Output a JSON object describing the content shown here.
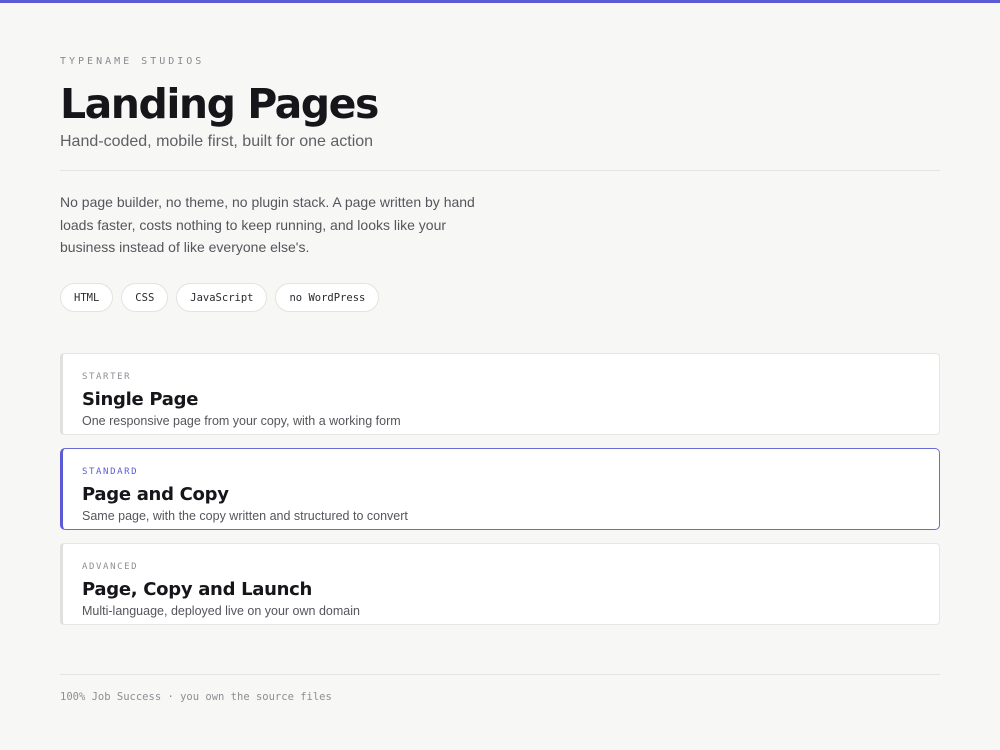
{
  "header": {
    "eyebrow": "TYPENAME STUDIOS",
    "title": "Landing Pages",
    "subtitle": "Hand-coded, mobile first, built for one action"
  },
  "intro": "No page builder, no theme, no plugin stack. A page written by hand loads faster, costs nothing to keep running, and looks like your business instead of like everyone else's.",
  "tags": [
    "HTML",
    "CSS",
    "JavaScript",
    "no WordPress"
  ],
  "packages": [
    {
      "tier": "STARTER",
      "name": "Single Page",
      "description": "One responsive page from your copy, with a working form",
      "selected": false
    },
    {
      "tier": "STANDARD",
      "name": "Page and Copy",
      "description": "Same page, with the copy written and structured to convert",
      "selected": true
    },
    {
      "tier": "ADVANCED",
      "name": "Page, Copy and Launch",
      "description": "Multi-language, deployed live on your own domain",
      "selected": false
    }
  ],
  "footer": "100% Job Success · you own the source files",
  "colors": {
    "accent": "#5b5bd6",
    "background": "#f7f7f5",
    "card": "#ffffff",
    "text": "#16161a",
    "muted": "#8e8e94"
  }
}
